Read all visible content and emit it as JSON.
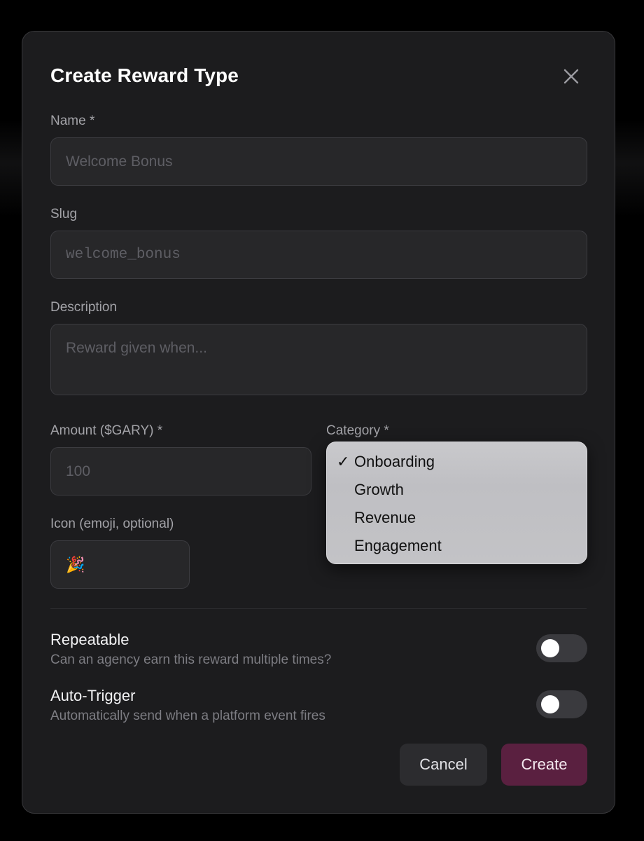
{
  "modal": {
    "title": "Create Reward Type"
  },
  "form": {
    "name": {
      "label": "Name *",
      "placeholder": "Welcome Bonus"
    },
    "slug": {
      "label": "Slug",
      "placeholder": "welcome_bonus"
    },
    "description": {
      "label": "Description",
      "placeholder": "Reward given when..."
    },
    "amount": {
      "label": "Amount ($GARY) *",
      "placeholder": "100"
    },
    "category": {
      "label": "Category *",
      "selected": "Onboarding",
      "options": [
        "Onboarding",
        "Growth",
        "Revenue",
        "Engagement"
      ]
    },
    "icon": {
      "label": "Icon (emoji, optional)",
      "value": "🎉"
    }
  },
  "options": {
    "repeatable": {
      "title": "Repeatable",
      "description": "Can an agency earn this reward multiple times?",
      "enabled": false
    },
    "auto_trigger": {
      "title": "Auto-Trigger",
      "description": "Automatically send when a platform event fires",
      "enabled": false
    }
  },
  "actions": {
    "cancel": "Cancel",
    "create": "Create"
  },
  "icons": {
    "close": "close-icon",
    "check": "checkmark-icon"
  },
  "colors": {
    "accent": "#5a2040",
    "background": "#1c1c1e"
  }
}
